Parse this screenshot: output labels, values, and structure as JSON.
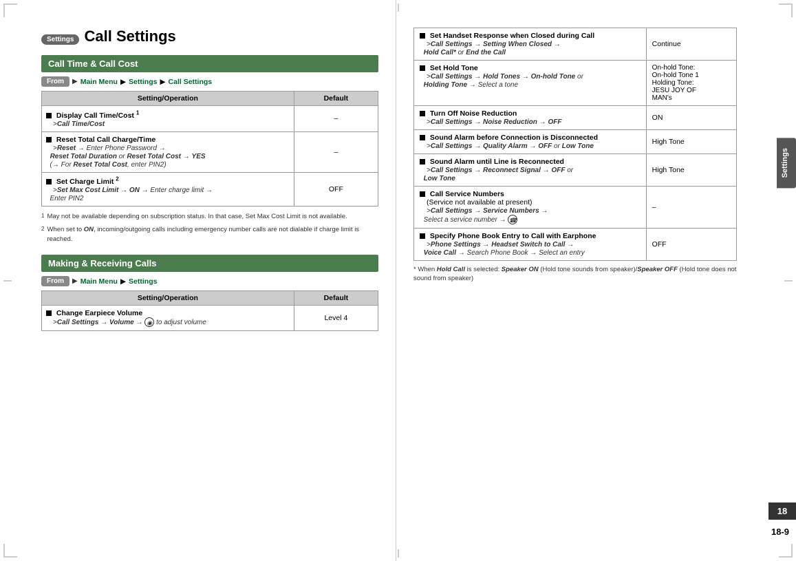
{
  "page": {
    "settings_badge": "Settings",
    "title": "Call Settings",
    "page_number": "18",
    "page_number_full": "18-9",
    "sidebar_label": "Settings"
  },
  "left": {
    "section1": {
      "header": "Call Time & Call Cost",
      "from_label": "From",
      "nav1": "Main Menu",
      "nav2": "Settings",
      "nav3": "Call Settings",
      "table_headers": [
        "Setting/Operation",
        "Default"
      ],
      "rows": [
        {
          "name": "Display Call Time/Cost",
          "superscript": "1",
          "path": "Call Time/Cost",
          "default": "–"
        },
        {
          "name": "Reset Total Call Charge/Time",
          "path_parts": [
            "Reset",
            "Enter Phone Password",
            "Reset Total Duration",
            "or",
            "Reset Total Cost",
            "YES",
            "For",
            "Reset Total Cost",
            "enter PIN2"
          ],
          "default": "–"
        },
        {
          "name": "Set Charge Limit",
          "superscript": "2",
          "path": "Set Max Cost Limit → ON → Enter charge limit → Enter PIN2",
          "default": "OFF"
        }
      ]
    },
    "footnotes": [
      {
        "num": "1",
        "text": "May not be available depending on subscription status. In that case, Set Max Cost Limit is not available."
      },
      {
        "num": "2",
        "text": "When set to ON, incoming/outgoing calls including emergency number calls are not dialable if charge limit is reached."
      }
    ],
    "section2": {
      "header": "Making & Receiving Calls",
      "from_label": "From",
      "nav1": "Main Menu",
      "nav2": "Settings",
      "table_headers": [
        "Setting/Operation",
        "Default"
      ],
      "rows": [
        {
          "name": "Change Earpiece Volume",
          "path": "Call Settings → Volume → [icon] to adjust volume",
          "default": "Level 4"
        }
      ]
    }
  },
  "right": {
    "rows": [
      {
        "setting": "Set Handset Response when Closed during Call",
        "path": "Call Settings → Setting When Closed → Hold Call* or End the Call",
        "default": "Continue"
      },
      {
        "setting": "Set Hold Tone",
        "path": "Call Settings → Hold Tones → On-hold Tone or Holding Tone → Select a tone",
        "default": "On-hold Tone: On-hold Tone 1\nHolding Tone: JESU JOY OF MAN's"
      },
      {
        "setting": "Turn Off Noise Reduction",
        "path": "Call Settings → Noise Reduction → OFF",
        "default": "ON"
      },
      {
        "setting": "Sound Alarm before Connection is Disconnected",
        "path": "Call Settings → Quality Alarm → OFF or Low Tone",
        "default": "High Tone"
      },
      {
        "setting": "Sound Alarm until Line is Reconnected",
        "path": "Call Settings → Reconnect Signal → OFF or Low Tone",
        "default": "High Tone"
      },
      {
        "setting": "Call Service Numbers",
        "sub": "(Service not available at present)",
        "path": "Call Settings → Service Numbers → Select a service number → [phone icon]",
        "default": "–"
      },
      {
        "setting": "Specify Phone Book Entry to Call with Earphone",
        "path": "Phone Settings → Headset Switch to Call → Voice Call → Search Phone Book → Select an entry",
        "default": "OFF"
      }
    ],
    "footnote": "* When Hold Call is selected: Speaker ON (Hold tone sounds from speaker)/Speaker OFF (Hold tone does not sound from speaker)"
  }
}
